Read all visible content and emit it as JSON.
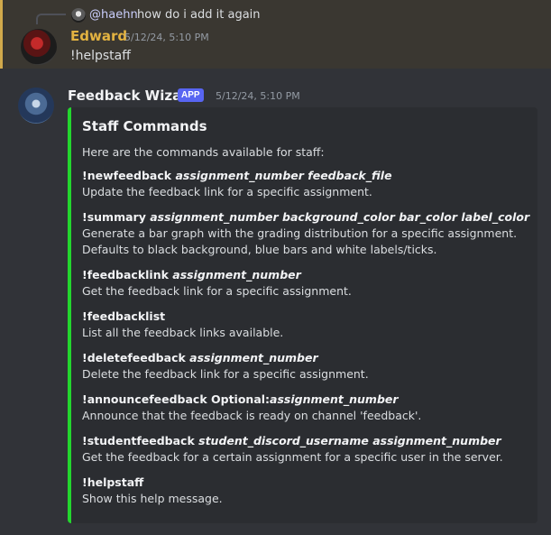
{
  "colors": {
    "background": "#313338",
    "highlight_background": "#3a3731",
    "highlight_border": "#d1a94b",
    "edward_name": "#e3b341",
    "embed_accent": "#23d62e",
    "app_badge": "#5865f2"
  },
  "reply": {
    "author": "@haehn",
    "text": "how do i add it again",
    "avatar_icon": "user-avatar"
  },
  "user_message": {
    "author": "Edward",
    "timestamp": "5/12/24, 5:10 PM",
    "content": "!helpstaff",
    "avatar_icon": "user-avatar"
  },
  "bot_message": {
    "author": "Feedback Wizard",
    "badge": "APP",
    "timestamp": "5/12/24, 5:10 PM",
    "avatar_icon": "wizard-avatar",
    "embed": {
      "title": "Staff Commands",
      "description": "Here are the commands available for staff:",
      "commands": [
        {
          "name": "!newfeedback",
          "args": "assignment_number feedback_file",
          "description": "Update the feedback link for a specific assignment."
        },
        {
          "name": "!summary",
          "args": "assignment_number background_color bar_color label_color",
          "description": "Generate a bar graph with the grading distribution for a specific assignment.\nDefaults to black background, blue bars and white labels/ticks."
        },
        {
          "name": "!feedbacklink",
          "args": "assignment_number",
          "description": "Get the feedback link for a specific assignment."
        },
        {
          "name": "!feedbacklist",
          "args": "",
          "description": "List all the feedback links available."
        },
        {
          "name": "!deletefeedback",
          "args": "assignment_number",
          "description": "Delete the feedback link for a specific assignment."
        },
        {
          "name": "!announcefeedback Optional:",
          "args": "assignment_number",
          "description": "Announce that the feedback is ready on channel 'feedback'."
        },
        {
          "name": "!studentfeedback",
          "args": "student_discord_username assignment_number",
          "description": "Get the feedback for a certain assignment for a specific user in the server."
        },
        {
          "name": "!helpstaff",
          "args": "",
          "description": "Show this help message."
        }
      ]
    }
  }
}
